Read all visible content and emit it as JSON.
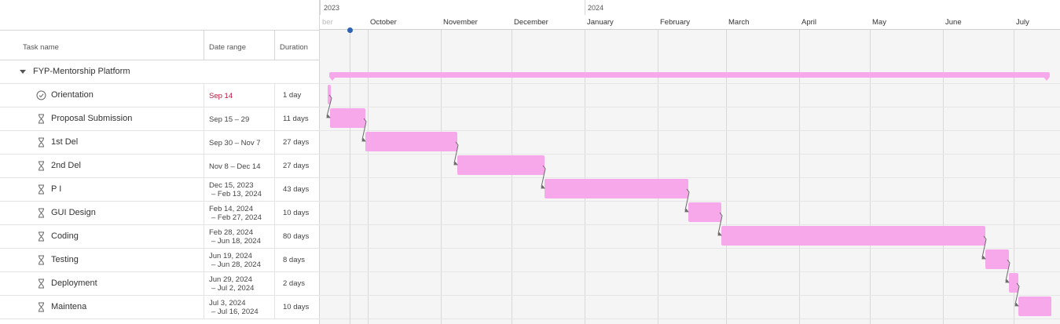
{
  "table": {
    "headers": {
      "task_name": "Task name",
      "date_range": "Date range",
      "duration": "Duration"
    },
    "group": {
      "name": "FYP-Mentorship Platform",
      "expanded": true
    },
    "tasks": [
      {
        "name": "Orientation",
        "icon": "milestone-check-icon",
        "date_line1": "Sep 14",
        "date_line2": "",
        "duration": "1 day",
        "date_color": "#c0143c"
      },
      {
        "name": "Proposal Submission",
        "icon": "hourglass-icon",
        "date_line1": "Sep 15 – 29",
        "date_line2": "",
        "duration": "11 days"
      },
      {
        "name": "1st Del",
        "icon": "hourglass-icon",
        "date_line1": "Sep 30 – Nov 7",
        "date_line2": "",
        "duration": "27 days"
      },
      {
        "name": "2nd Del",
        "icon": "hourglass-icon",
        "date_line1": "Nov 8 – Dec 14",
        "date_line2": "",
        "duration": "27 days"
      },
      {
        "name": "P I",
        "icon": "hourglass-icon",
        "date_line1": "Dec 15, 2023",
        "date_line2": "– Feb 13, 2024",
        "duration": "43 days"
      },
      {
        "name": "GUI Design",
        "icon": "hourglass-icon",
        "date_line1": "Feb 14, 2024",
        "date_line2": "– Feb 27, 2024",
        "duration": "10 days"
      },
      {
        "name": "Coding",
        "icon": "hourglass-icon",
        "date_line1": "Feb 28, 2024",
        "date_line2": "– Jun 18, 2024",
        "duration": "80 days"
      },
      {
        "name": "Testing",
        "icon": "hourglass-icon",
        "date_line1": "Jun 19, 2024",
        "date_line2": "– Jun 28, 2024",
        "duration": "8 days"
      },
      {
        "name": "Deployment",
        "icon": "hourglass-icon",
        "date_line1": "Jun 29, 2024",
        "date_line2": "– Jul 2, 2024",
        "duration": "2 days"
      },
      {
        "name": "Maintena",
        "icon": "hourglass-icon",
        "date_line1": "Jul 3, 2024",
        "date_line2": "– Jul 16, 2024",
        "duration": "10 days"
      }
    ]
  },
  "timeline": {
    "years": [
      "2023",
      "2024"
    ],
    "partial_month_label": "ber",
    "months": [
      "October",
      "November",
      "December",
      "January",
      "February",
      "March",
      "April",
      "May",
      "June",
      "July"
    ]
  },
  "colors": {
    "bar": "#f7a8ea",
    "today_marker": "#2f62b4",
    "overdue_text": "#c0143c"
  }
}
